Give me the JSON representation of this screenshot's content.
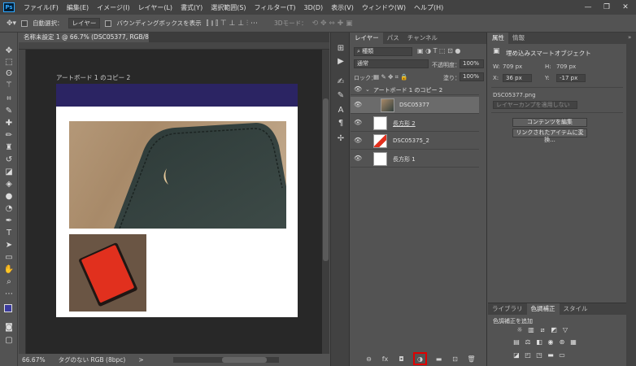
{
  "menubar": {
    "items": [
      "ファイル(F)",
      "編集(E)",
      "イメージ(I)",
      "レイヤー(L)",
      "書式(Y)",
      "選択範囲(S)",
      "フィルター(T)",
      "3D(D)",
      "表示(V)",
      "ウィンドウ(W)",
      "ヘルプ(H)"
    ],
    "controls": [
      "—",
      "❐",
      "✕"
    ]
  },
  "options": {
    "auto_select_label": "自動選択：",
    "auto_select_value": "レイヤー",
    "bounding_box_label": "バウンディングボックスを表示",
    "mode_3d_label": "3Dモード："
  },
  "document": {
    "tab_title": "名称未設定 1 @ 66.7% (DSC05377, RGB/8#) *",
    "tab_close": "✕",
    "artboard_label": "アートボード 1 のコピー 2",
    "zoom": "66.67%",
    "status_info": "タグのない RGB (8bpc)"
  },
  "layers": {
    "tabs": [
      "レイヤー",
      "パス",
      "チャンネル"
    ],
    "kind_filter": "種類",
    "blend_mode": "通常",
    "opacity_label": "不透明度：",
    "opacity_value": "100%",
    "lock_label": "ロック：",
    "fill_label": "塗り：",
    "fill_value": "100%",
    "artboard_group": "アートボード 1 のコピー 2",
    "rows": [
      {
        "name": "DSC05377"
      },
      {
        "name": "長方形 2"
      },
      {
        "name": "DSC05375_2"
      },
      {
        "name": "長方形 1"
      }
    ]
  },
  "properties": {
    "tabs": [
      "属性",
      "情報"
    ],
    "type": "埋め込みスマートオブジェクト",
    "w_label": "W:",
    "w_value": "709 px",
    "h_label": "H:",
    "h_value": "709 px",
    "x_label": "X:",
    "x_value": "36 px",
    "y_label": "Y:",
    "y_value": "-17 px",
    "filename": "DSC05377.png",
    "comp_placeholder": "レイヤーカンプを適用しない",
    "edit_contents": "コンテンツを編集",
    "convert_linked": "リンクされたアイテムに変換..."
  },
  "adjustments": {
    "tabs": [
      "ライブラリ",
      "色調補正",
      "スタイル"
    ],
    "add_label": "色調補正を追加"
  },
  "colors": {
    "accent_red": "#e00000",
    "artboard_header": "#2b2463"
  }
}
